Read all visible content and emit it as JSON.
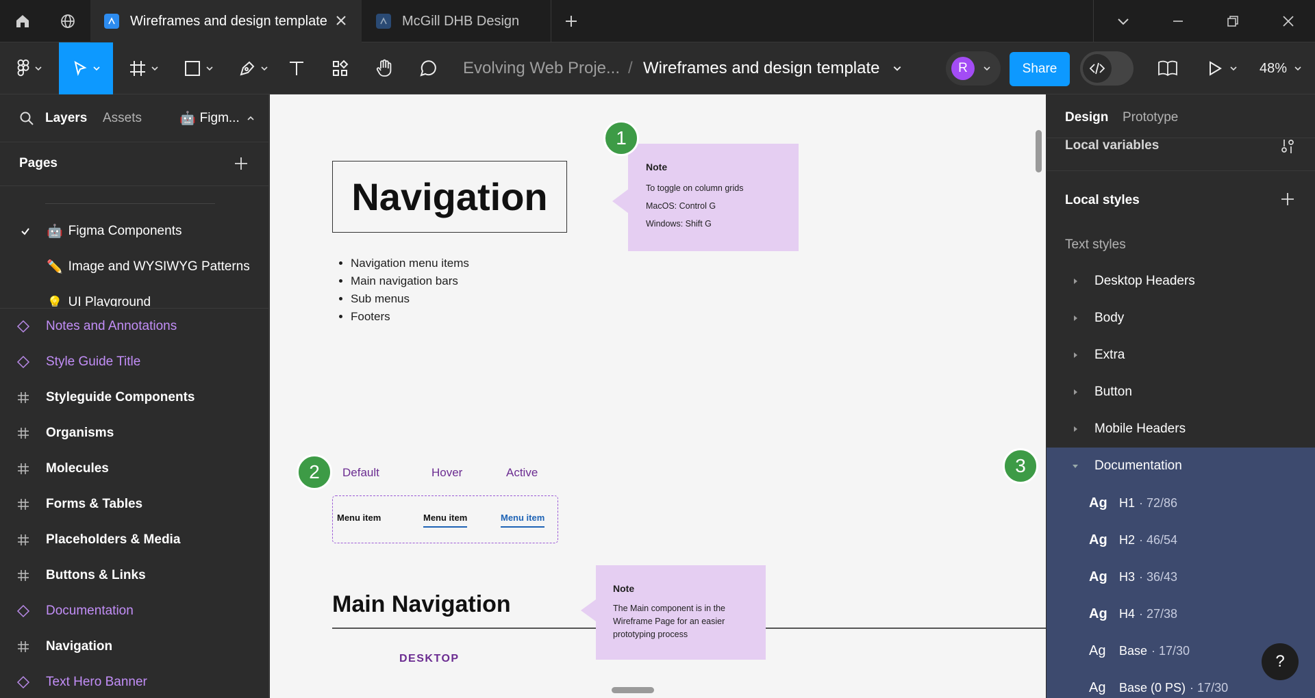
{
  "tabs": [
    {
      "title": "Wireframes and design template",
      "active": true
    },
    {
      "title": "McGill DHB Design",
      "active": false
    }
  ],
  "toolbar": {
    "project": "Evolving Web Proje...",
    "separator": "/",
    "file": "Wireframes and design template",
    "avatar": "R",
    "share": "Share",
    "zoom": "48%"
  },
  "left": {
    "tab_layers": "Layers",
    "tab_assets": "Assets",
    "page_selector": "Figm...",
    "pages_title": "Pages",
    "pages": [
      {
        "emoji": "🤖",
        "label": "Figma Components",
        "checked": true
      },
      {
        "emoji": "✏️",
        "label": "Image and WYSIWYG Patterns",
        "checked": false
      },
      {
        "emoji": "💡",
        "label": "UI Playground",
        "checked": false
      }
    ],
    "layers": [
      {
        "kind": "comp",
        "label": "Notes and Annotations"
      },
      {
        "kind": "comp",
        "label": "Style Guide Title"
      },
      {
        "kind": "frame",
        "label": "Styleguide Components"
      },
      {
        "kind": "frame",
        "label": "Organisms"
      },
      {
        "kind": "frame",
        "label": "Molecules"
      },
      {
        "kind": "frame",
        "label": "Forms & Tables"
      },
      {
        "kind": "frame",
        "label": "Placeholders & Media"
      },
      {
        "kind": "frame",
        "label": "Buttons & Links"
      },
      {
        "kind": "comp",
        "label": "Documentation"
      },
      {
        "kind": "frame",
        "label": "Navigation"
      },
      {
        "kind": "comp",
        "label": "Text Hero Banner"
      }
    ]
  },
  "canvas": {
    "nav_title": "Navigation",
    "bullets": [
      "Navigation menu items",
      "Main navigation bars",
      "Sub menus",
      "Footers"
    ],
    "note1": {
      "title": "Note",
      "lines": [
        "To toggle on column grids",
        "MacOS: Control G",
        "Windows: Shift G"
      ]
    },
    "badges": [
      "1",
      "2",
      "3"
    ],
    "states": [
      "Default",
      "Hover",
      "Active"
    ],
    "menu_items": [
      "Menu item",
      "Menu item",
      "Menu item"
    ],
    "main_nav_title": "Main Navigation",
    "note2": {
      "title": "Note",
      "text": "The Main component is in the Wireframe Page for an easier prototyping process"
    },
    "desktop_label": "DESKTOP"
  },
  "right": {
    "tab_design": "Design",
    "tab_prototype": "Prototype",
    "local_variables": "Local variables",
    "local_styles": "Local styles",
    "text_styles": "Text styles",
    "groups": [
      {
        "label": "Desktop Headers",
        "expanded": false
      },
      {
        "label": "Body",
        "expanded": false
      },
      {
        "label": "Extra",
        "expanded": false
      },
      {
        "label": "Button",
        "expanded": false
      },
      {
        "label": "Mobile Headers",
        "expanded": false
      },
      {
        "label": "Documentation",
        "expanded": true
      }
    ],
    "styles": [
      {
        "ag": "Ag",
        "name": "H1",
        "spec": "· 72/86",
        "bold": true
      },
      {
        "ag": "Ag",
        "name": "H2",
        "spec": "· 46/54",
        "bold": true
      },
      {
        "ag": "Ag",
        "name": "H3",
        "spec": "· 36/43",
        "bold": true
      },
      {
        "ag": "Ag",
        "name": "H4",
        "spec": "· 27/38",
        "bold": true
      },
      {
        "ag": "Ag",
        "name": "Base",
        "spec": "· 17/30",
        "bold": false
      },
      {
        "ag": "Ag",
        "name": "Base (0 PS)",
        "spec": "· 17/30",
        "bold": false
      }
    ],
    "help": "?"
  },
  "colors": {
    "accent": "#0d99ff",
    "component": "#c28ef7",
    "note": "#e5cef2",
    "badge": "#3d9b46",
    "selection": "#3d4a6e",
    "nav_purple": "#6b2c91"
  }
}
